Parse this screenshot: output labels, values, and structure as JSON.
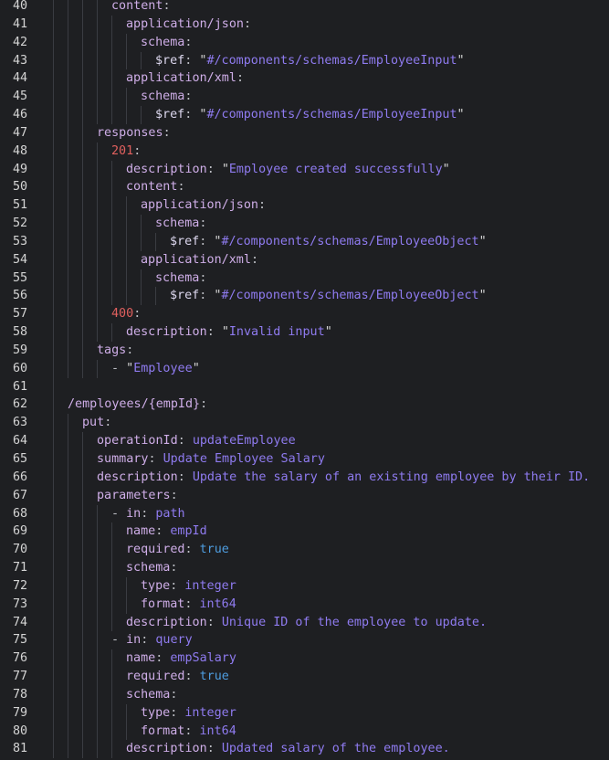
{
  "editor": {
    "lines": [
      {
        "num": "40",
        "indent": 4,
        "parts": [
          {
            "t": "content",
            "c": "k"
          },
          {
            "t": ":",
            "c": "p"
          }
        ]
      },
      {
        "num": "41",
        "indent": 5,
        "parts": [
          {
            "t": "application/json",
            "c": "k"
          },
          {
            "t": ":",
            "c": "p"
          }
        ]
      },
      {
        "num": "42",
        "indent": 6,
        "parts": [
          {
            "t": "schema",
            "c": "k"
          },
          {
            "t": ":",
            "c": "p"
          }
        ]
      },
      {
        "num": "43",
        "indent": 7,
        "parts": [
          {
            "t": "$ref",
            "c": "ref"
          },
          {
            "t": ": ",
            "c": "p"
          },
          {
            "t": "\"",
            "c": "q"
          },
          {
            "t": "#/components/schemas/EmployeeInput",
            "c": "s"
          },
          {
            "t": "\"",
            "c": "q"
          }
        ]
      },
      {
        "num": "44",
        "indent": 5,
        "parts": [
          {
            "t": "application/xml",
            "c": "k"
          },
          {
            "t": ":",
            "c": "p"
          }
        ]
      },
      {
        "num": "45",
        "indent": 6,
        "parts": [
          {
            "t": "schema",
            "c": "k"
          },
          {
            "t": ":",
            "c": "p"
          }
        ]
      },
      {
        "num": "46",
        "indent": 7,
        "parts": [
          {
            "t": "$ref",
            "c": "ref"
          },
          {
            "t": ": ",
            "c": "p"
          },
          {
            "t": "\"",
            "c": "q"
          },
          {
            "t": "#/components/schemas/EmployeeInput",
            "c": "s"
          },
          {
            "t": "\"",
            "c": "q"
          }
        ]
      },
      {
        "num": "47",
        "indent": 3,
        "parts": [
          {
            "t": "responses",
            "c": "k"
          },
          {
            "t": ":",
            "c": "p"
          }
        ]
      },
      {
        "num": "48",
        "indent": 4,
        "parts": [
          {
            "t": "201",
            "c": "n"
          },
          {
            "t": ":",
            "c": "p"
          }
        ]
      },
      {
        "num": "49",
        "indent": 5,
        "parts": [
          {
            "t": "description",
            "c": "k"
          },
          {
            "t": ": ",
            "c": "p"
          },
          {
            "t": "\"",
            "c": "q"
          },
          {
            "t": "Employee created successfully",
            "c": "s"
          },
          {
            "t": "\"",
            "c": "q"
          }
        ]
      },
      {
        "num": "50",
        "indent": 5,
        "parts": [
          {
            "t": "content",
            "c": "k"
          },
          {
            "t": ":",
            "c": "p"
          }
        ]
      },
      {
        "num": "51",
        "indent": 6,
        "parts": [
          {
            "t": "application/json",
            "c": "k"
          },
          {
            "t": ":",
            "c": "p"
          }
        ]
      },
      {
        "num": "52",
        "indent": 7,
        "parts": [
          {
            "t": "schema",
            "c": "k"
          },
          {
            "t": ":",
            "c": "p"
          }
        ]
      },
      {
        "num": "53",
        "indent": 8,
        "parts": [
          {
            "t": "$ref",
            "c": "ref"
          },
          {
            "t": ": ",
            "c": "p"
          },
          {
            "t": "\"",
            "c": "q"
          },
          {
            "t": "#/components/schemas/EmployeeObject",
            "c": "s"
          },
          {
            "t": "\"",
            "c": "q"
          }
        ]
      },
      {
        "num": "54",
        "indent": 6,
        "parts": [
          {
            "t": "application/xml",
            "c": "k"
          },
          {
            "t": ":",
            "c": "p"
          }
        ]
      },
      {
        "num": "55",
        "indent": 7,
        "parts": [
          {
            "t": "schema",
            "c": "k"
          },
          {
            "t": ":",
            "c": "p"
          }
        ]
      },
      {
        "num": "56",
        "indent": 8,
        "parts": [
          {
            "t": "$ref",
            "c": "ref"
          },
          {
            "t": ": ",
            "c": "p"
          },
          {
            "t": "\"",
            "c": "q"
          },
          {
            "t": "#/components/schemas/EmployeeObject",
            "c": "s"
          },
          {
            "t": "\"",
            "c": "q"
          }
        ]
      },
      {
        "num": "57",
        "indent": 4,
        "parts": [
          {
            "t": "400",
            "c": "n"
          },
          {
            "t": ":",
            "c": "p"
          }
        ]
      },
      {
        "num": "58",
        "indent": 5,
        "parts": [
          {
            "t": "description",
            "c": "k"
          },
          {
            "t": ": ",
            "c": "p"
          },
          {
            "t": "\"",
            "c": "q"
          },
          {
            "t": "Invalid input",
            "c": "s"
          },
          {
            "t": "\"",
            "c": "q"
          }
        ]
      },
      {
        "num": "59",
        "indent": 3,
        "parts": [
          {
            "t": "tags",
            "c": "k"
          },
          {
            "t": ":",
            "c": "p"
          }
        ]
      },
      {
        "num": "60",
        "indent": 4,
        "parts": [
          {
            "t": "- ",
            "c": "p"
          },
          {
            "t": "\"",
            "c": "q"
          },
          {
            "t": "Employee",
            "c": "s"
          },
          {
            "t": "\"",
            "c": "q"
          }
        ]
      },
      {
        "num": "61",
        "indent": 0,
        "parts": []
      },
      {
        "num": "62",
        "indent": 1,
        "parts": [
          {
            "t": "/employees/{empId}",
            "c": "k"
          },
          {
            "t": ":",
            "c": "p"
          }
        ]
      },
      {
        "num": "63",
        "indent": 2,
        "parts": [
          {
            "t": "put",
            "c": "k"
          },
          {
            "t": ":",
            "c": "p"
          }
        ]
      },
      {
        "num": "64",
        "indent": 3,
        "parts": [
          {
            "t": "operationId",
            "c": "k"
          },
          {
            "t": ": ",
            "c": "p"
          },
          {
            "t": "updateEmployee",
            "c": "v"
          }
        ]
      },
      {
        "num": "65",
        "indent": 3,
        "parts": [
          {
            "t": "summary",
            "c": "k"
          },
          {
            "t": ": ",
            "c": "p"
          },
          {
            "t": "Update Employee Salary",
            "c": "v"
          }
        ]
      },
      {
        "num": "66",
        "indent": 3,
        "parts": [
          {
            "t": "description",
            "c": "k"
          },
          {
            "t": ": ",
            "c": "p"
          },
          {
            "t": "Update the salary of an existing employee by their ID.",
            "c": "v"
          }
        ]
      },
      {
        "num": "67",
        "indent": 3,
        "parts": [
          {
            "t": "parameters",
            "c": "k"
          },
          {
            "t": ":",
            "c": "p"
          }
        ]
      },
      {
        "num": "68",
        "indent": 4,
        "parts": [
          {
            "t": "- ",
            "c": "p"
          },
          {
            "t": "in",
            "c": "k"
          },
          {
            "t": ": ",
            "c": "p"
          },
          {
            "t": "path",
            "c": "v"
          }
        ]
      },
      {
        "num": "69",
        "indent": 5,
        "parts": [
          {
            "t": "name",
            "c": "k"
          },
          {
            "t": ": ",
            "c": "p"
          },
          {
            "t": "empId",
            "c": "v"
          }
        ]
      },
      {
        "num": "70",
        "indent": 5,
        "parts": [
          {
            "t": "required",
            "c": "k"
          },
          {
            "t": ": ",
            "c": "p"
          },
          {
            "t": "true",
            "c": "b"
          }
        ]
      },
      {
        "num": "71",
        "indent": 5,
        "parts": [
          {
            "t": "schema",
            "c": "k"
          },
          {
            "t": ":",
            "c": "p"
          }
        ]
      },
      {
        "num": "72",
        "indent": 6,
        "parts": [
          {
            "t": "type",
            "c": "k"
          },
          {
            "t": ": ",
            "c": "p"
          },
          {
            "t": "integer",
            "c": "v"
          }
        ]
      },
      {
        "num": "73",
        "indent": 6,
        "parts": [
          {
            "t": "format",
            "c": "k"
          },
          {
            "t": ": ",
            "c": "p"
          },
          {
            "t": "int64",
            "c": "v"
          }
        ]
      },
      {
        "num": "74",
        "indent": 5,
        "parts": [
          {
            "t": "description",
            "c": "k"
          },
          {
            "t": ": ",
            "c": "p"
          },
          {
            "t": "Unique ID of the employee to update.",
            "c": "v"
          }
        ]
      },
      {
        "num": "75",
        "indent": 4,
        "parts": [
          {
            "t": "- ",
            "c": "p"
          },
          {
            "t": "in",
            "c": "k"
          },
          {
            "t": ": ",
            "c": "p"
          },
          {
            "t": "query",
            "c": "v"
          }
        ]
      },
      {
        "num": "76",
        "indent": 5,
        "parts": [
          {
            "t": "name",
            "c": "k"
          },
          {
            "t": ": ",
            "c": "p"
          },
          {
            "t": "empSalary",
            "c": "v"
          }
        ]
      },
      {
        "num": "77",
        "indent": 5,
        "parts": [
          {
            "t": "required",
            "c": "k"
          },
          {
            "t": ": ",
            "c": "p"
          },
          {
            "t": "true",
            "c": "b"
          }
        ]
      },
      {
        "num": "78",
        "indent": 5,
        "parts": [
          {
            "t": "schema",
            "c": "k"
          },
          {
            "t": ":",
            "c": "p"
          }
        ]
      },
      {
        "num": "79",
        "indent": 6,
        "parts": [
          {
            "t": "type",
            "c": "k"
          },
          {
            "t": ": ",
            "c": "p"
          },
          {
            "t": "integer",
            "c": "v"
          }
        ]
      },
      {
        "num": "80",
        "indent": 6,
        "parts": [
          {
            "t": "format",
            "c": "k"
          },
          {
            "t": ": ",
            "c": "p"
          },
          {
            "t": "int64",
            "c": "v"
          }
        ]
      },
      {
        "num": "81",
        "indent": 5,
        "parts": [
          {
            "t": "description",
            "c": "k"
          },
          {
            "t": ": ",
            "c": "p"
          },
          {
            "t": "Updated salary of the employee.",
            "c": "v"
          }
        ]
      }
    ]
  },
  "colors": {
    "background": "#1e1f22",
    "line_number": "#d4d4d4",
    "key": "#cfaee8",
    "value": "#8f7bf0",
    "status_code": "#e0605e",
    "boolean": "#4e9de0",
    "indent_guide": "#3a3c42"
  }
}
